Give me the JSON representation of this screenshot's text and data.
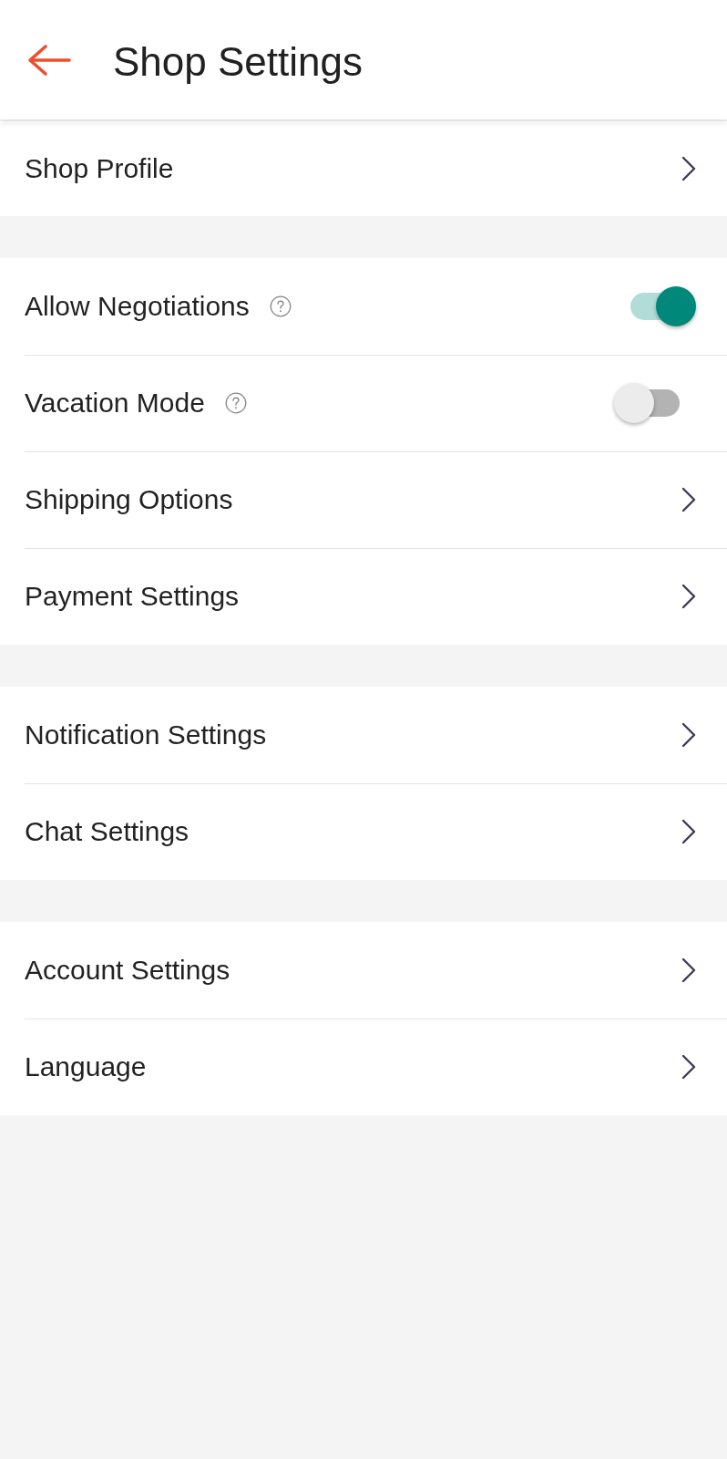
{
  "header": {
    "title": "Shop Settings"
  },
  "sections": [
    {
      "items": [
        {
          "label": "Shop Profile",
          "kind": "link"
        }
      ]
    },
    {
      "items": [
        {
          "label": "Allow Negotiations",
          "kind": "toggle",
          "help": true,
          "on": true
        },
        {
          "label": "Vacation Mode",
          "kind": "toggle",
          "help": true,
          "on": false
        },
        {
          "label": "Shipping Options",
          "kind": "link"
        },
        {
          "label": "Payment Settings",
          "kind": "link"
        }
      ]
    },
    {
      "items": [
        {
          "label": "Notification Settings",
          "kind": "link"
        },
        {
          "label": "Chat Settings",
          "kind": "link"
        }
      ]
    },
    {
      "items": [
        {
          "label": "Account Settings",
          "kind": "link"
        },
        {
          "label": "Language",
          "kind": "link"
        }
      ]
    }
  ]
}
